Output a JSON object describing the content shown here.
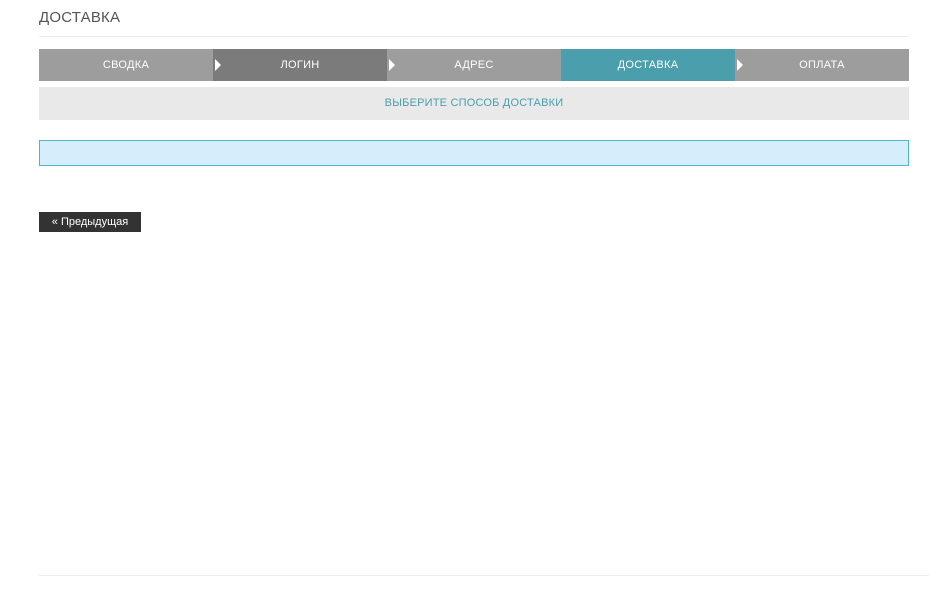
{
  "page": {
    "title": "ДОСТАВКА"
  },
  "steps": [
    {
      "label": "СВОДКА"
    },
    {
      "label": "ЛОГИН"
    },
    {
      "label": "АДРЕС"
    },
    {
      "label": "ДОСТАВКА"
    },
    {
      "label": "ОПЛАТА"
    }
  ],
  "instruction": "ВЫБЕРИТЕ СПОСОБ ДОСТАВКИ",
  "navigation": {
    "prev_label": "« Предыдущая"
  },
  "colors": {
    "step_default": "#9d9d9d",
    "step_visited": "#7b7b7b",
    "step_current": "#4b9fad",
    "info_box_bg": "#d6eefb",
    "info_box_border": "#4bb8c8",
    "button_bg": "#333333"
  }
}
